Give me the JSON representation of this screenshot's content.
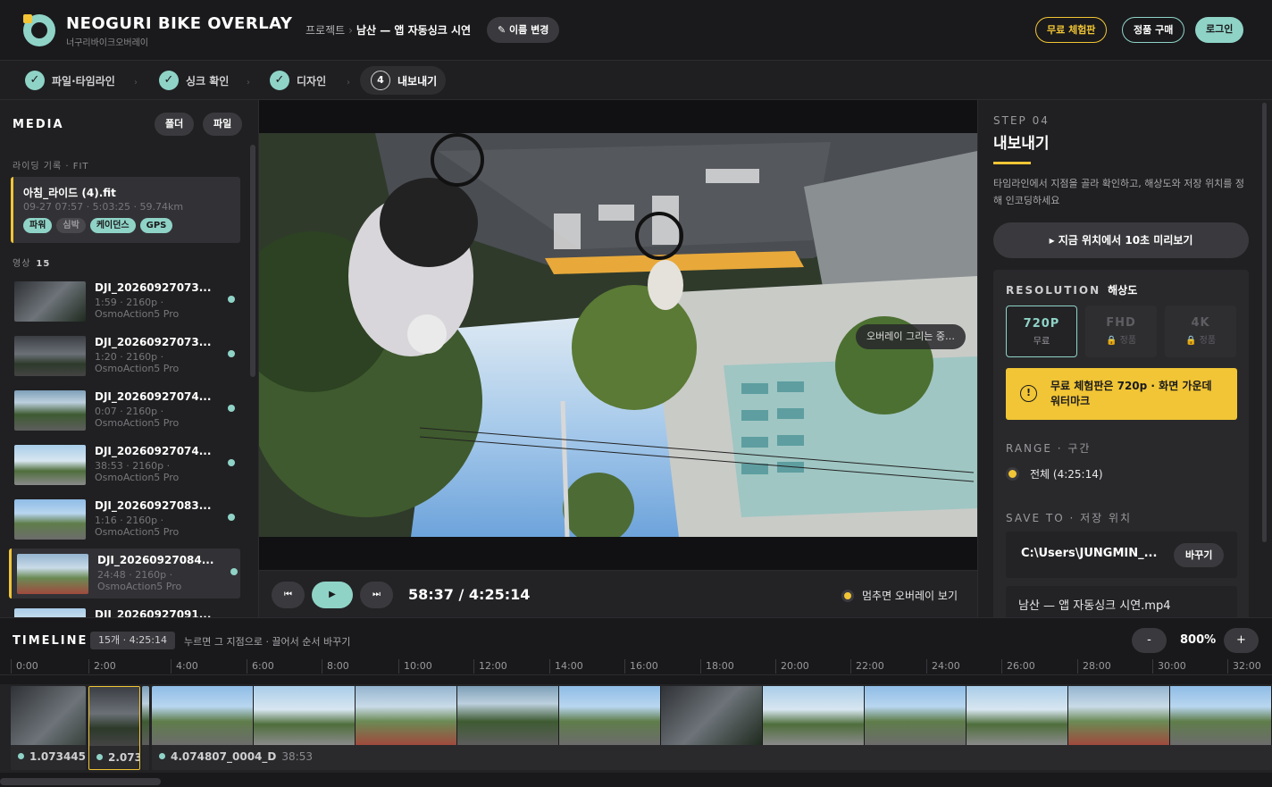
{
  "app": {
    "brand": "NEOGURI BIKE OVERLAY",
    "brand_sub": "너구리바이크오버레이",
    "breadcrumb_root": "프로젝트",
    "breadcrumb_sep": "›",
    "project_name": "남산 — 앱 자동싱크 시연",
    "rename_label": "✎ 이름 변경",
    "trial_label": "무료 체험판",
    "buy_label": "정품 구매",
    "login_label": "로그인"
  },
  "steps": [
    {
      "label": "파일·타임라인",
      "done": true,
      "icon": "check-icon"
    },
    {
      "label": "싱크 확인",
      "done": true,
      "icon": "check-icon"
    },
    {
      "label": "디자인",
      "done": true,
      "icon": "check-icon"
    },
    {
      "label": "내보내기",
      "done": false,
      "num": "4"
    }
  ],
  "step_sep": "›",
  "media": {
    "title": "MEDIA",
    "folder_btn": "폴더",
    "file_btn": "파일",
    "fit_section": "라이딩 기록 · FIT",
    "fit": {
      "name": "아침_라이드 (4).fit",
      "meta": "09-27 07:57 · 5:03:25 · 59.74km",
      "tags": [
        {
          "label": "파워",
          "active": true
        },
        {
          "label": "심박",
          "active": false
        },
        {
          "label": "케이던스",
          "active": true
        },
        {
          "label": "GPS",
          "active": true
        }
      ]
    },
    "video_section": "영상",
    "video_count": "15",
    "videos": [
      {
        "name": "DJI_20260927073...",
        "meta1": "1:59 · 2160p ·",
        "meta2": "OsmoAction5 Pro",
        "selected": false
      },
      {
        "name": "DJI_20260927073...",
        "meta1": "1:20 · 2160p ·",
        "meta2": "OsmoAction5 Pro",
        "selected": false
      },
      {
        "name": "DJI_20260927074...",
        "meta1": "0:07 · 2160p ·",
        "meta2": "OsmoAction5 Pro",
        "selected": false
      },
      {
        "name": "DJI_20260927074...",
        "meta1": "38:53 · 2160p ·",
        "meta2": "OsmoAction5 Pro",
        "selected": false
      },
      {
        "name": "DJI_20260927083...",
        "meta1": "1:16 · 2160p ·",
        "meta2": "OsmoAction5 Pro",
        "selected": false
      },
      {
        "name": "DJI_20260927084...",
        "meta1": "24:48 · 2160p ·",
        "meta2": "OsmoAction5 Pro",
        "selected": true
      },
      {
        "name": "DJI_20260927091...",
        "meta1": "",
        "meta2": "",
        "selected": false
      }
    ]
  },
  "preview": {
    "overlay_status": "오버레이 그리는 중…",
    "prev_icon": "⏮",
    "play_icon": "▶",
    "next_icon": "⏭",
    "time": "58:37 / 4:25:14",
    "pause_overlay_label": "멈추면 오버레이 보기",
    "pause_overlay_on": true
  },
  "export": {
    "step": "STEP 04",
    "title": "내보내기",
    "desc": "타임라인에서 지점을 골라 확인하고, 해상도와 저장 위치를 정해 인코딩하세요",
    "preview_btn": "▸ 지금 위치에서 10초 미리보기",
    "resolution_label": "RESOLUTION",
    "resolution_ko": "해상도",
    "resolutions": [
      {
        "name": "720P",
        "sub": "무료",
        "locked": false,
        "selected": true
      },
      {
        "name": "FHD",
        "sub": "🔒 정품",
        "locked": true,
        "selected": false
      },
      {
        "name": "4K",
        "sub": "🔒 정품",
        "locked": true,
        "selected": false
      }
    ],
    "warning_icon": "!",
    "warning": "무료 체험판은 720p · 화면 가운데 워터마크",
    "range_label": "RANGE · 구간",
    "range_value": "전체 (4:25:14)",
    "save_label": "SAVE TO · 저장 위치",
    "save_path": "C:\\Users\\JUNGMIN_...",
    "change_btn": "바꾸기",
    "filename": "남산 — 앱 자동싱크 시연.mp4"
  },
  "timeline": {
    "title": "TIMELINE",
    "count": "15개 · 4:25:14",
    "hint": "누르면 그 지점으로 · 끌어서 순서 바꾸기",
    "zoom_minus": "-",
    "zoom": "800%",
    "zoom_plus": "+",
    "ticks": [
      "0:00",
      "2:00",
      "4:00",
      "6:00",
      "8:00",
      "10:00",
      "12:00",
      "14:00",
      "16:00",
      "18:00",
      "20:00",
      "22:00",
      "24:00",
      "26:00",
      "28:00",
      "30:00",
      "32:00"
    ],
    "clips": [
      {
        "label": "1.073445",
        "duration": ""
      },
      {
        "label": "2.073",
        "duration": ""
      },
      {
        "label": "4.074807_0004_D",
        "duration": "38:53"
      }
    ]
  }
}
